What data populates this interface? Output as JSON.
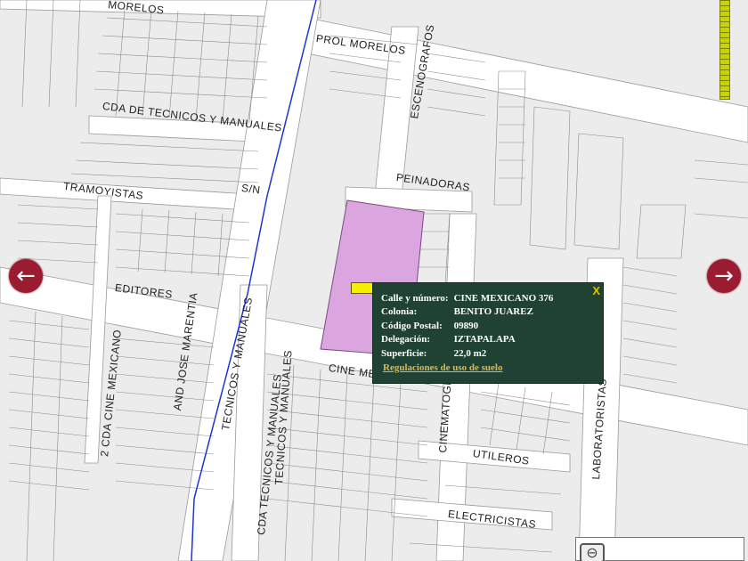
{
  "map": {
    "streets": {
      "morelos": "MORELOS",
      "prol_morelos": "PROL MORELOS",
      "escenografos": "ESCENOGRAFOS",
      "cda_tecnicos": "CDA DE TECNICOS Y MANUALES",
      "tramoyistas": "TRAMOYISTAS",
      "sn": "S/N",
      "peinadoras": "PEINADORAS",
      "editores": "EDITORES",
      "and_jose_marentia": "AND JOSE MARENTIA",
      "tecnicos_manuales": "TECNICOS Y MANUALES",
      "cda_cine_mexicano": "2 CDA CINE MEXICANO",
      "cine_mexicano": "CINE MEXICANO",
      "tecnicos_manuales_2": "TECNICOS Y MANUALES",
      "cda_tecnicos_2": "CDA TECNICOS Y MANUALES",
      "cinematografistas": "CINEMATOGRAFISTAS",
      "laboratoristas": "LABORATORISTAS",
      "utileros": "UTILEROS",
      "electricistas": "ELECTRICISTAS"
    },
    "highlight_color": "#dba6e0",
    "road_color": "#ffffff",
    "block_color": "#ececec",
    "line_color": "#1d33d6"
  },
  "nav": {
    "left_icon": "arrow-left-icon",
    "right_icon": "arrow-right-icon",
    "left_glyph": "←",
    "right_glyph": "→",
    "color": "#9b1b30"
  },
  "popup": {
    "close_label": "X",
    "rows": [
      {
        "label": "Calle y número:",
        "value": "CINE MEXICANO 376"
      },
      {
        "label": "Colonia:",
        "value": "BENITO JUAREZ"
      },
      {
        "label": "Código Postal:",
        "value": "09890"
      },
      {
        "label": "Delegación:",
        "value": "IZTAPALAPA"
      },
      {
        "label": "Superficie:",
        "value": "22,0 m2"
      }
    ],
    "link": "Regulaciones de uso de suelo",
    "bg_color": "#1f4233",
    "link_color": "#e0b74f"
  },
  "controls": {
    "zoom_out_glyph": "⊖",
    "zoom_out_icon": "zoom-out-icon"
  }
}
